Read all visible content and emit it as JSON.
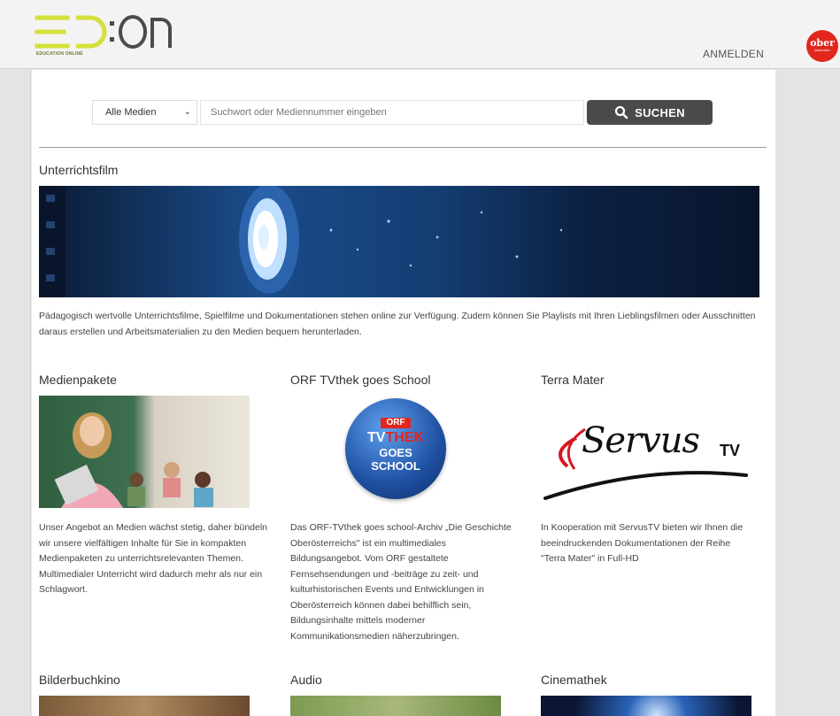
{
  "header": {
    "logo_text": "ED:ON",
    "logo_subtitle": "EDUCATION ONLINE",
    "login_label": "ANMELDEN",
    "partner_badge": {
      "line1": "ober",
      "line2": "österreich"
    }
  },
  "search": {
    "media_select_value": "Alle Medien",
    "placeholder": "Suchwort oder Mediennummer eingeben",
    "button_label": "SUCHEN"
  },
  "featured": {
    "title": "Unterrichtsfilm",
    "description": "Pädagogisch wertvolle Unterrichtsfilme, Spielfilme und Dokumentationen stehen online zur Verfügung. Zudem können Sie Playlists mit Ihren Lieblingsfilmen oder Ausschnitten daraus erstellen und Arbeitsmaterialien zu den Medien bequem herunterladen."
  },
  "cards": [
    {
      "title": "Medienpakete",
      "text": "Unser Angebot an Medien wächst stetig, daher bündeln wir unsere vielfältigen Inhalte für Sie in kompakten Medienpaketen zu unterrichtsrelevanten Themen. Multimedialer Unterricht wird dadurch mehr als nur ein Schlagwort."
    },
    {
      "title": "ORF TVthek goes School",
      "badge": {
        "orf": "ORF",
        "tv": "TV",
        "thek": "THEK",
        "goes": "GOES",
        "school": "SCHOOL"
      },
      "text": "Das ORF-TVthek goes school-Archiv „Die Geschichte Oberösterreichs\" ist ein multimediales Bildungsangebot. Vom ORF gestaltete Fernsehsendungen und -beiträge zu zeit- und kulturhistorischen Events und Entwicklungen in Oberösterreich können dabei behilflich sein, Bildungsinhalte mittels moderner Kommunikationsmedien näherzubringen."
    },
    {
      "title": "Terra Mater",
      "logo": {
        "main": "Servus",
        "suffix": "TV"
      },
      "text": "In Kooperation mit ServusTV bieten wir Ihnen die beeindruckenden Dokumentationen der Reihe \"Terra Mater\" in Full-HD"
    },
    {
      "title": "Bilderbuchkino"
    },
    {
      "title": "Audio"
    },
    {
      "title": "Cinemathek"
    }
  ],
  "colors": {
    "logo_green": "#d4e03b",
    "logo_grey": "#4b4b4b",
    "search_button": "#4a4a4a",
    "badge_red": "#e1261c",
    "orf_blue": "#1e4fa0"
  }
}
